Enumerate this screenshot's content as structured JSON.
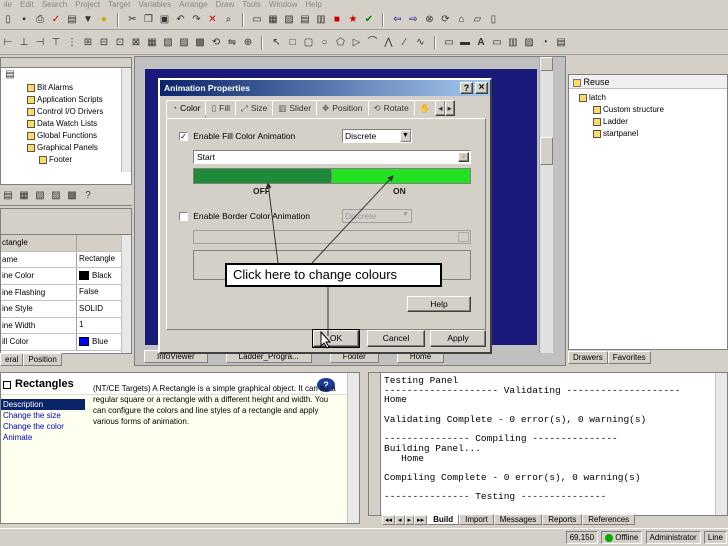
{
  "menu": [
    "ile",
    "Edit",
    "Search",
    "Project",
    "Target",
    "Variables",
    "Arrange",
    "Draw",
    "Tools",
    "Window",
    "Help"
  ],
  "project_tree": {
    "items": [
      {
        "label": "Bit Alarms",
        "indent": 1
      },
      {
        "label": "Application Scripts",
        "indent": 1
      },
      {
        "label": "Control I/O Drivers",
        "indent": 1
      },
      {
        "label": "Data Watch Lists",
        "indent": 1
      },
      {
        "label": "Global Functions",
        "indent": 1
      },
      {
        "label": "Graphical Panels",
        "indent": 1
      },
      {
        "label": "Footer",
        "indent": 2
      }
    ]
  },
  "property_grid": {
    "header_key": "ctangle",
    "header_value": "",
    "rows": [
      {
        "key": "ame",
        "value": "Rectangle"
      },
      {
        "key": "ine Color",
        "value": "Black",
        "swatch": "#000000"
      },
      {
        "key": "ine Flashing",
        "value": "False"
      },
      {
        "key": "ine Style",
        "value": "SOLID"
      },
      {
        "key": "ine Width",
        "value": "1"
      },
      {
        "key": "ill Color",
        "value": "Blue",
        "swatch": "#0000ff"
      }
    ],
    "tabs": [
      "eral",
      "Position"
    ]
  },
  "dialog": {
    "title": "Animation Properties",
    "help_button": "?",
    "close_button": "×",
    "tabs": [
      "Color",
      "Fill",
      "Size",
      "Slider",
      "Position",
      "Rotate"
    ],
    "enable_fill_label": "Enable Fill Color Animation",
    "enable_fill_checked": true,
    "fill_mode": "Discrete",
    "expression": "Start",
    "off_label": "OFF",
    "on_label": "ON",
    "off_color": "#1e8a3a",
    "on_color": "#22e022",
    "enable_border_label": "Enable Border Color Animation",
    "enable_border_checked": false,
    "border_mode": "Discrete",
    "help_label": "Help",
    "ok_label": "OK",
    "cancel_label": "Cancel",
    "apply_label": "Apply"
  },
  "callout": "Click here to change colours",
  "panel_tabs": [
    "InfoViewer",
    "Ladder_Progra...",
    "Footer",
    "Home"
  ],
  "reuse": {
    "title": "Reuse",
    "items": [
      {
        "label": "latch",
        "indent": 0
      },
      {
        "label": "Custom structure",
        "indent": 1
      },
      {
        "label": "Ladder",
        "indent": 1
      },
      {
        "label": "startpanel",
        "indent": 1
      }
    ],
    "tabs": [
      "Drawers",
      "Favorites"
    ]
  },
  "info": {
    "title": "Rectangles",
    "links": [
      "Description",
      "Change the size",
      "Change the color",
      "Animate"
    ],
    "body": "(NT/CE Targets) A Rectangle is a simple graphical object. It can be a regular square or a rectangle with a different height and width. You can configure the colors and line styles of a rectangle and apply various forms of animation.",
    "body_prefix": "(NT/CE Targets)"
  },
  "output": {
    "lines": [
      "Testing Panel",
      "-------------------- Validating --------------------",
      "Home",
      "",
      "Validating Complete - 0 error(s), 0 warning(s)",
      "",
      "--------------- Compiling ---------------",
      "Building Panel...",
      "   Home",
      "",
      "Compiling Complete - 0 error(s), 0 warning(s)",
      "",
      "--------------- Testing ---------------"
    ],
    "tabs": [
      "Build",
      "Import",
      "Messages",
      "Reports",
      "References"
    ],
    "active_tab": "Build"
  },
  "status": {
    "coords": "69,150",
    "mode": "Offline",
    "user": "Administrator",
    "cap": "Line"
  }
}
